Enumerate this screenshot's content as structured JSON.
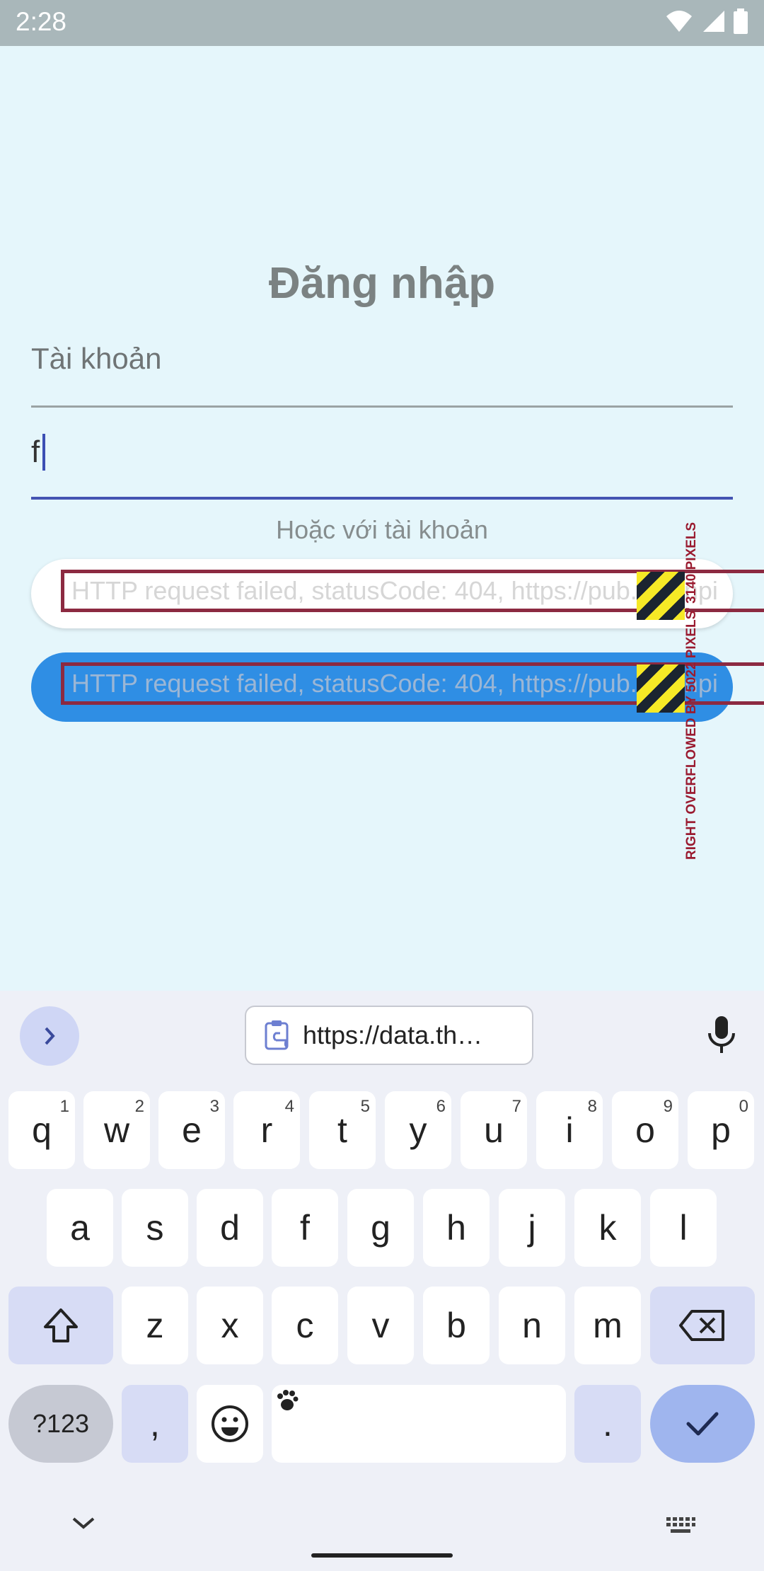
{
  "status_bar": {
    "time": "2:28"
  },
  "login": {
    "title": "Đăng nhập",
    "account_label": "Tài khoản",
    "account_value": "f",
    "or_text": "Hoặc với tài khoản",
    "error_text_1": "HTTP request failed, statusCode: 404, https://pub.cleanpi",
    "error_text_2": "HTTP request failed, statusCode: 404, https://pub.cleanpi",
    "overflow_label": "RIGHT OVERFLOWED BY 5022 PIXELS' 3140 PIXELS"
  },
  "keyboard": {
    "clipboard_text": "https://data.th…",
    "row1": [
      {
        "key": "q",
        "hint": "1"
      },
      {
        "key": "w",
        "hint": "2"
      },
      {
        "key": "e",
        "hint": "3"
      },
      {
        "key": "r",
        "hint": "4"
      },
      {
        "key": "t",
        "hint": "5"
      },
      {
        "key": "y",
        "hint": "6"
      },
      {
        "key": "u",
        "hint": "7"
      },
      {
        "key": "i",
        "hint": "8"
      },
      {
        "key": "o",
        "hint": "9"
      },
      {
        "key": "p",
        "hint": "0"
      }
    ],
    "row2": [
      "a",
      "s",
      "d",
      "f",
      "g",
      "h",
      "j",
      "k",
      "l"
    ],
    "row3": [
      "z",
      "x",
      "c",
      "v",
      "b",
      "n",
      "m"
    ],
    "symbols_label": "?123",
    "comma": ",",
    "period": "."
  }
}
